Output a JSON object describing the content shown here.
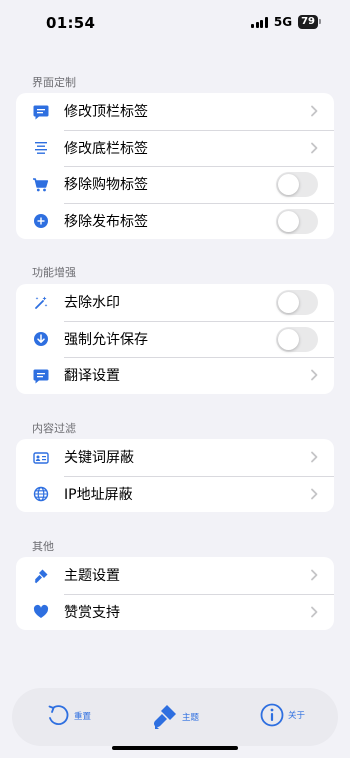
{
  "status_bar": {
    "time": "01:54",
    "network": "5G",
    "battery": "79"
  },
  "sections": [
    {
      "title": "界面定制",
      "rows": [
        {
          "label": "修改顶栏标签",
          "icon": "message-square-icon",
          "control": "chevron"
        },
        {
          "label": "修改底栏标签",
          "icon": "align-center-icon",
          "control": "chevron"
        },
        {
          "label": "移除购物标签",
          "icon": "shopping-cart-icon",
          "control": "toggle",
          "on": false
        },
        {
          "label": "移除发布标签",
          "icon": "plus-circle-icon",
          "control": "toggle",
          "on": false
        }
      ]
    },
    {
      "title": "功能增强",
      "rows": [
        {
          "label": "去除水印",
          "icon": "magic-wand-icon",
          "control": "toggle",
          "on": false
        },
        {
          "label": "强制允许保存",
          "icon": "arrow-down-circle-icon",
          "control": "toggle",
          "on": false
        },
        {
          "label": "翻译设置",
          "icon": "message-square-icon",
          "control": "chevron"
        }
      ]
    },
    {
      "title": "内容过滤",
      "rows": [
        {
          "label": "关键词屏蔽",
          "icon": "id-card-icon",
          "control": "chevron"
        },
        {
          "label": "IP地址屏蔽",
          "icon": "globe-icon",
          "control": "chevron"
        }
      ]
    },
    {
      "title": "其他",
      "rows": [
        {
          "label": "主题设置",
          "icon": "paintbrush-icon",
          "control": "chevron"
        },
        {
          "label": "赞赏支持",
          "icon": "heart-icon",
          "control": "chevron"
        }
      ]
    }
  ],
  "tabbar": {
    "reset": "重置",
    "theme": "主题",
    "about": "关于"
  },
  "colors": {
    "accent": "#2e6fe0",
    "background": "#f2f2f7",
    "toggle_off": "#e9e9ea",
    "chevron": "#c4c4c7"
  }
}
